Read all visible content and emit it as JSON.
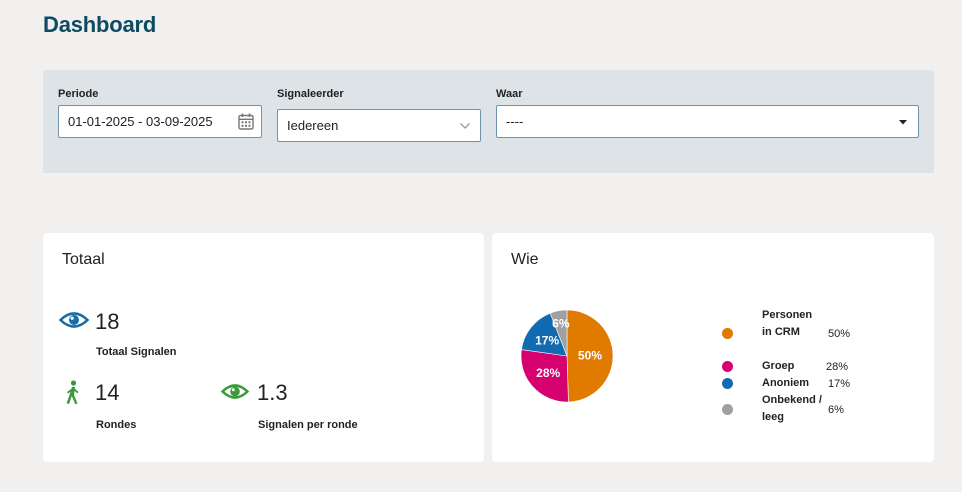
{
  "page": {
    "title": "Dashboard"
  },
  "filters": {
    "periode": {
      "label": "Periode",
      "value": "01-01-2025 - 03-09-2025"
    },
    "signaleerder": {
      "label": "Signaleerder",
      "value": "Iedereen"
    },
    "waar": {
      "label": "Waar",
      "value": "----"
    }
  },
  "totaal": {
    "title": "Totaal",
    "signalen": {
      "value": "18",
      "label": "Totaal Signalen"
    },
    "rondes": {
      "value": "14",
      "label": "Rondes"
    },
    "per_ronde": {
      "value": "1.3",
      "label": "Signalen per ronde"
    }
  },
  "wie": {
    "title": "Wie",
    "legend": [
      {
        "label": "Personen in CRM",
        "pct": "50%"
      },
      {
        "label": "Groep",
        "pct": "28%"
      },
      {
        "label": "Anoniem",
        "pct": "17%"
      },
      {
        "label": "Onbekend / leeg",
        "pct": "6%"
      }
    ]
  },
  "colors": {
    "title": "#0f4a63",
    "eye_blue": "#1a6ea5",
    "green": "#3a9a3a",
    "personen": "#e07b00",
    "groep": "#d6006f",
    "anoniem": "#126bb0",
    "onbekend": "#a0a0a0"
  },
  "chart_data": {
    "type": "pie",
    "categories": [
      "Personen in CRM",
      "Groep",
      "Anoniem",
      "Onbekend / leeg"
    ],
    "values": [
      50,
      28,
      17,
      6
    ],
    "labels": [
      "50%",
      "28%",
      "17%",
      "6%"
    ],
    "colors": [
      "#e07b00",
      "#d6006f",
      "#126bb0",
      "#a0a0a0"
    ],
    "title": "Wie",
    "legend": "right"
  }
}
